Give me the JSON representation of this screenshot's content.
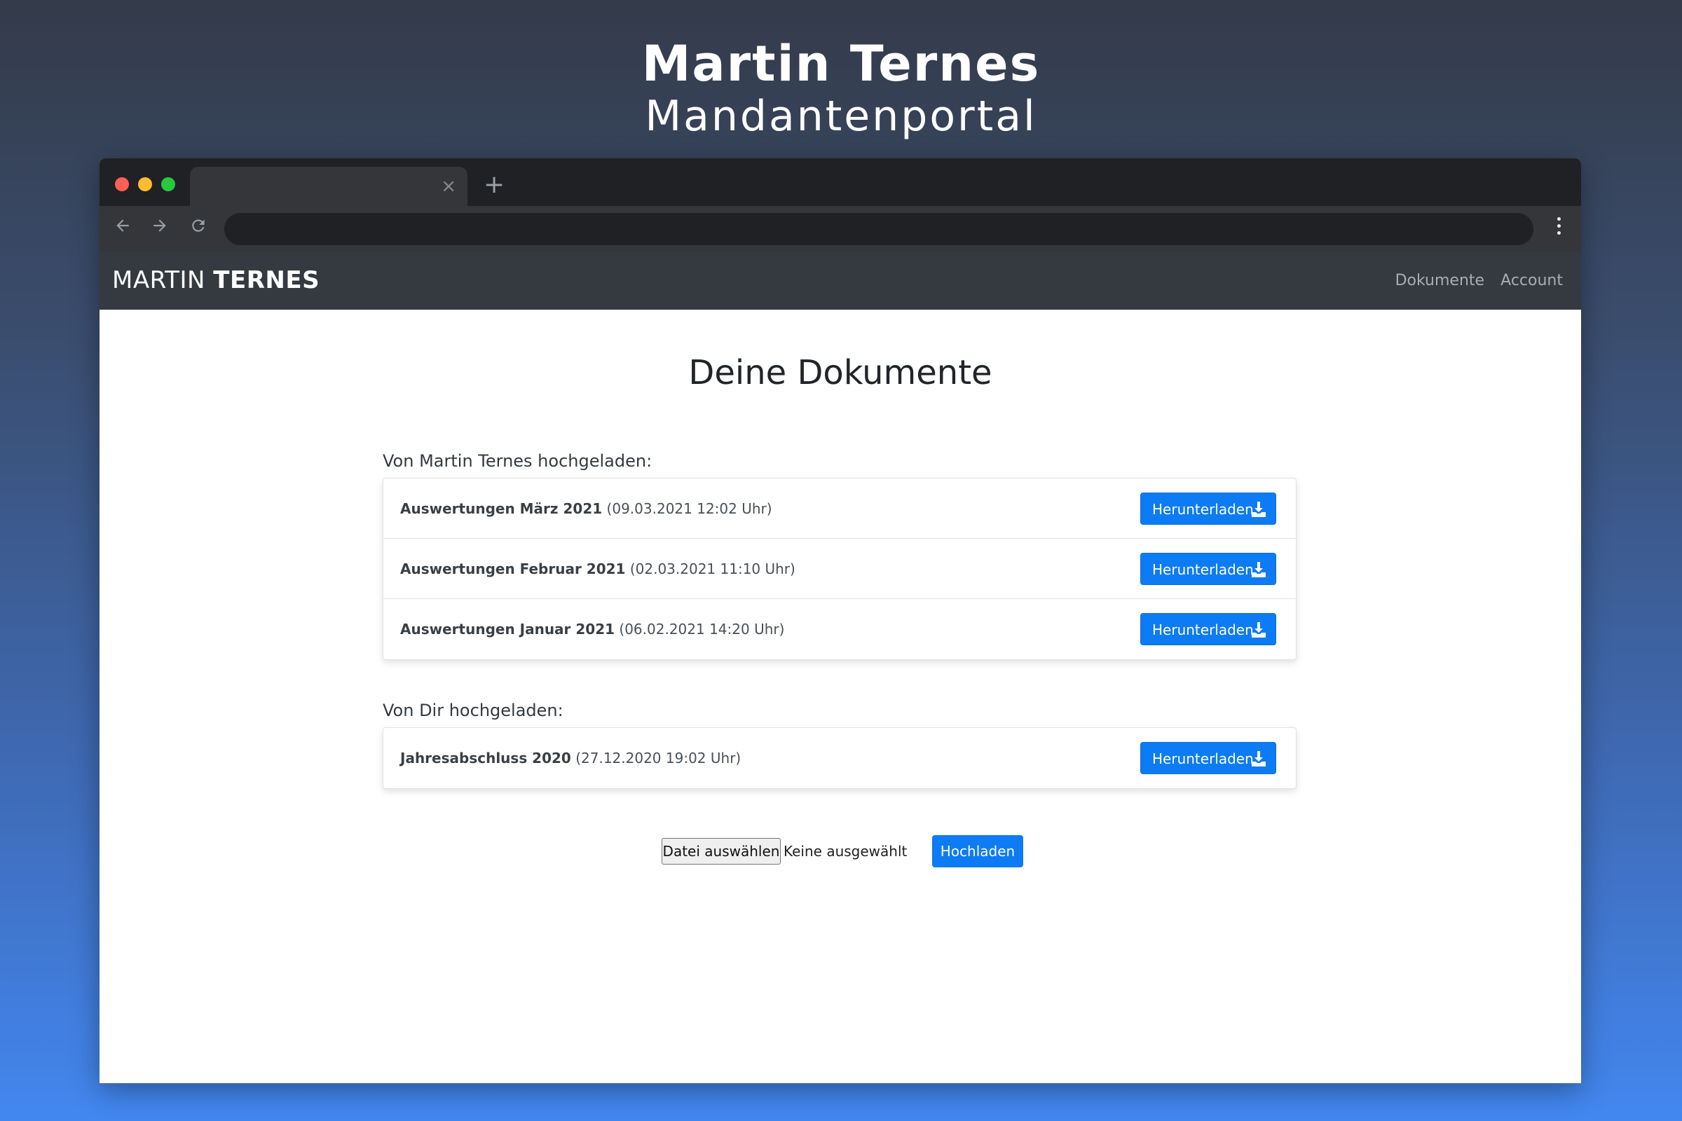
{
  "hero": {
    "title": "Martin Ternes",
    "subtitle": "Mandantenportal"
  },
  "browser": {
    "tab_close": "×",
    "new_tab": "+"
  },
  "app": {
    "brand_light": "MARTIN",
    "brand_bold": "TERNES",
    "nav": [
      "Dokumente",
      "Account"
    ]
  },
  "page": {
    "title": "Deine Dokumente"
  },
  "sections": [
    {
      "label": "Von Martin Ternes hochgeladen:",
      "items": [
        {
          "name": "Auswertungen März 2021",
          "date": "(09.03.2021 12:02 Uhr)",
          "button": "Herunterladen"
        },
        {
          "name": "Auswertungen Februar 2021",
          "date": "(02.03.2021 11:10 Uhr)",
          "button": "Herunterladen"
        },
        {
          "name": "Auswertungen Januar 2021",
          "date": "(06.02.2021 14:20 Uhr)",
          "button": "Herunterladen"
        }
      ]
    },
    {
      "label": "Von Dir hochgeladen:",
      "items": [
        {
          "name": "Jahresabschluss 2020",
          "date": "(27.12.2020 19:02 Uhr)",
          "button": "Herunterladen"
        }
      ]
    }
  ],
  "upload": {
    "file_button": "Datei auswählen",
    "file_status": "Keine ausgewählt",
    "submit": "Hochladen"
  },
  "colors": {
    "primary": "#0d7bf3",
    "navbar": "#343a40",
    "gradient_top": "#343b4a",
    "gradient_bottom": "#4287f0"
  }
}
